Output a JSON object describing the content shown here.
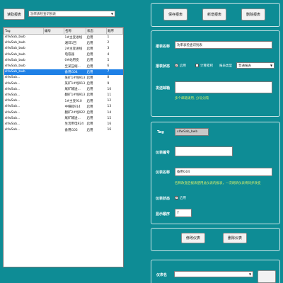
{
  "top": {
    "read_button": "读取报表",
    "report_select": "功率表检查识别表",
    "save_button": "保存报表",
    "new_button": "新增报表",
    "delete_button": "删除报表"
  },
  "table": {
    "headers": [
      "Tag",
      "编号",
      "名称",
      "状态",
      "顺序"
    ],
    "rows": [
      [
        "xlfwSab_bwb",
        "",
        "1#主变进线",
        "启用",
        "1"
      ],
      [
        "xlfwSab_bwb",
        "",
        "湘日1回",
        "启用",
        "2"
      ],
      [
        "xlfwSab_bwb",
        "",
        "2#主变进线",
        "启用",
        "3"
      ],
      [
        "xlfwSab_bwb",
        "",
        "电容器",
        "启用",
        "4"
      ],
      [
        "xlfwSab_bwb",
        "",
        "0#站用变",
        "启用",
        "5"
      ],
      [
        "xlfwSab_bwb",
        "",
        "至某压缩...",
        "启用",
        "6"
      ],
      [
        "xlfwSab_bwb",
        "",
        "备用G04",
        "启用",
        "7"
      ],
      [
        "xlfwSab...",
        "",
        "某矿1#线913",
        "启用",
        "8"
      ],
      [
        "xlfwSab...",
        "",
        "某矿1#线913",
        "启用",
        "9"
      ],
      [
        "xlfwSab...",
        "",
        "尾矿输送...",
        "启用",
        "10"
      ],
      [
        "xlfwSab...",
        "",
        "翻矿1#线913",
        "启用",
        "11"
      ],
      [
        "xlfwSab...",
        "",
        "1#主变910",
        "启用",
        "12"
      ],
      [
        "xlfwSab...",
        "",
        "中细碎914",
        "启用",
        "13"
      ],
      [
        "xlfwSab...",
        "",
        "翻矿2#线922",
        "启用",
        "14"
      ],
      [
        "xlfwSab...",
        "",
        "尾矿输送...",
        "启用",
        "15"
      ],
      [
        "xlfwSab...",
        "",
        "生活用电924",
        "启用",
        "16"
      ],
      [
        "xlfwSab...",
        "",
        "备用G05",
        "启用",
        "16"
      ]
    ],
    "selected_index": 6
  },
  "report_form": {
    "name_label": "报表名称",
    "name_value": "功率表检查识别表",
    "status_label": "报表状态",
    "enabled_label": "启用",
    "enabled_checked": true,
    "calc_label": "计算累积",
    "calc_checked": false,
    "type_label": "报表类型",
    "type_value": "普通报表",
    "email_label": "发送邮箱",
    "email_value": "",
    "email_note": "多个邮箱请用, 分号分隔"
  },
  "meter_form": {
    "tag_label": "Tag",
    "tag_value": "xlfwSab_bwb",
    "code_label": "仪表编号",
    "code_value": "",
    "name_label": "仪表名称",
    "name_value": "备用G04",
    "warning": "名称改变后报表使用此仪表的报表，一次刷新仪表将同步改变",
    "status_label": "仪表状态",
    "enabled_label": "启用",
    "enabled_checked": true,
    "order_label": "显示顺序",
    "order_value": "7",
    "modify_button": "修改仪表",
    "delete_button": "删除仪表"
  },
  "bottom": {
    "meter_label": "仪表名",
    "meter_select": ""
  }
}
